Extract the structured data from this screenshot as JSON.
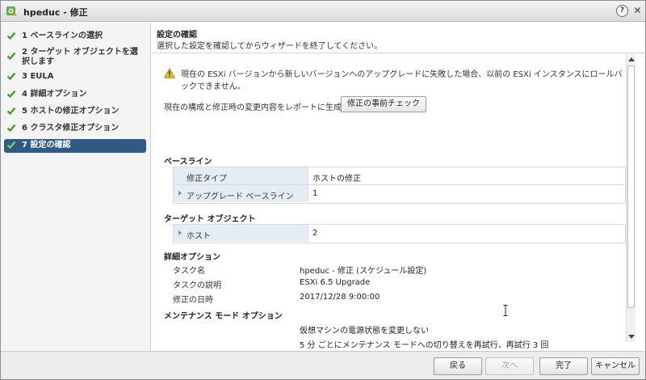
{
  "window": {
    "title": "hpeduc - 修正",
    "help_label": "?",
    "close_label": "✕"
  },
  "nav": {
    "items": [
      {
        "label": "1  ベースラインの選択"
      },
      {
        "label": "2  ターゲット オブジェクトを選択します"
      },
      {
        "label": "3  EULA"
      },
      {
        "label": "4  詳細オプション"
      },
      {
        "label": "5  ホストの修正オプション"
      },
      {
        "label": "6  クラスタ修正オプション"
      },
      {
        "label": "7  設定の確認"
      }
    ]
  },
  "header": {
    "title": "設定の確認",
    "subtitle": "選択した設定を確認してからウィザードを終了してください。"
  },
  "warning": {
    "text": "現在の ESXi バージョンから新しいバージョンへのアップグレードに失敗した場合、以前の ESXi インスタンスにロールバックできません。"
  },
  "report": {
    "label": "現在の構成と修正時の変更内容をレポートに生成:",
    "button": "修正の事前チェック"
  },
  "baseline": {
    "title": "ベースライン",
    "rows": [
      {
        "key": "修正タイプ",
        "value": "ホストの修正"
      },
      {
        "key": "アップグレード ベースライン",
        "value": "1"
      }
    ]
  },
  "target": {
    "title": "ターゲット オブジェクト",
    "rows": [
      {
        "key": "ホスト",
        "value": "2"
      }
    ]
  },
  "advanced": {
    "title": "詳細オプション",
    "rows": [
      {
        "key": "タスク名",
        "value": "hpeduc - 修正 (スケジュール設定)"
      },
      {
        "key": "タスクの説明",
        "value": "ESXi 6.5 Upgrade"
      },
      {
        "key": "修正の日時",
        "value": "2017/12/28 9:00:00"
      }
    ]
  },
  "maintenance": {
    "title": "メンテナンス モード オプション",
    "lines": [
      "仮想マシンの電源状態を変更しない",
      "5 分 ごとにメンテナンス モードへの切り替えを再試行、再試行 3 回"
    ]
  },
  "footer": {
    "back": "戻る",
    "next": "次へ",
    "finish": "完了",
    "cancel": "キャンセル"
  }
}
